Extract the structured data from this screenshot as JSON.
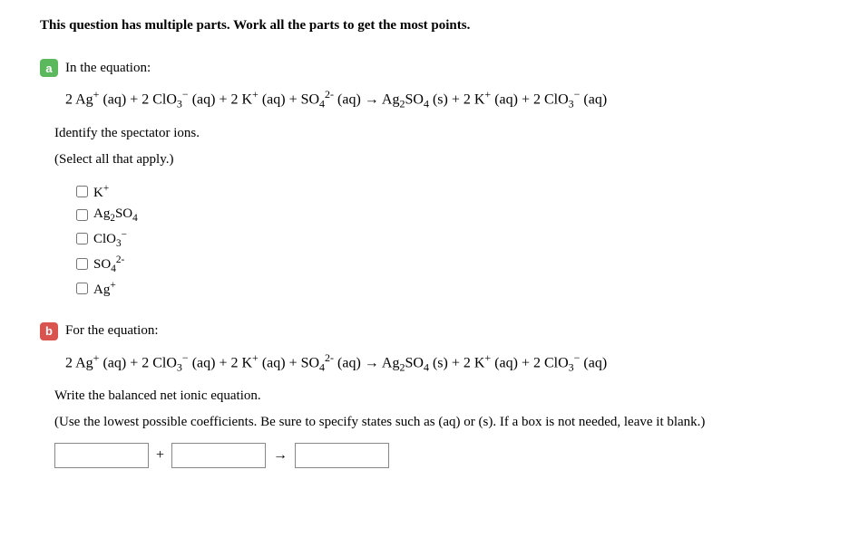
{
  "header": "This question has multiple parts. Work all the parts to get the most points.",
  "partA": {
    "badge": "a",
    "title": "In the equation:",
    "equation": "2 Ag⁺ (aq) + 2 ClO₃⁻ (aq) + 2 K⁺ (aq) + SO₄²⁻ (aq) → Ag₂SO₄ (s) + 2 K⁺ (aq) + 2 ClO₃⁻ (aq)",
    "instruction": "Identify the spectator ions.",
    "sub_instruction": "(Select all that apply.)",
    "options": [
      {
        "label": "K⁺",
        "html": "K<sup>+</sup>"
      },
      {
        "label": "Ag₂SO₄",
        "html": "Ag<sub>2</sub>SO<sub>4</sub>"
      },
      {
        "label": "ClO₃⁻",
        "html": "ClO<sub>3</sub><sup>&minus;</sup>"
      },
      {
        "label": "SO₄²⁻",
        "html": "SO<sub>4</sub><sup>2-</sup>"
      },
      {
        "label": "Ag⁺",
        "html": "Ag<sup>+</sup>"
      }
    ]
  },
  "partB": {
    "badge": "b",
    "title": "For the equation:",
    "equation": "2 Ag⁺ (aq) + 2 ClO₃⁻ (aq) + 2 K⁺ (aq) + SO₄²⁻ (aq) → Ag₂SO₄ (s) + 2 K⁺ (aq) + 2 ClO₃⁻ (aq)",
    "instruction": "Write the balanced net ionic equation.",
    "sub_instruction": "(Use the lowest possible coefficients. Be sure to specify states such as (aq) or (s). If a box is not needed, leave it blank.)",
    "op_plus": "+",
    "op_arrow": "→",
    "box1": "",
    "box2": "",
    "box3": ""
  }
}
